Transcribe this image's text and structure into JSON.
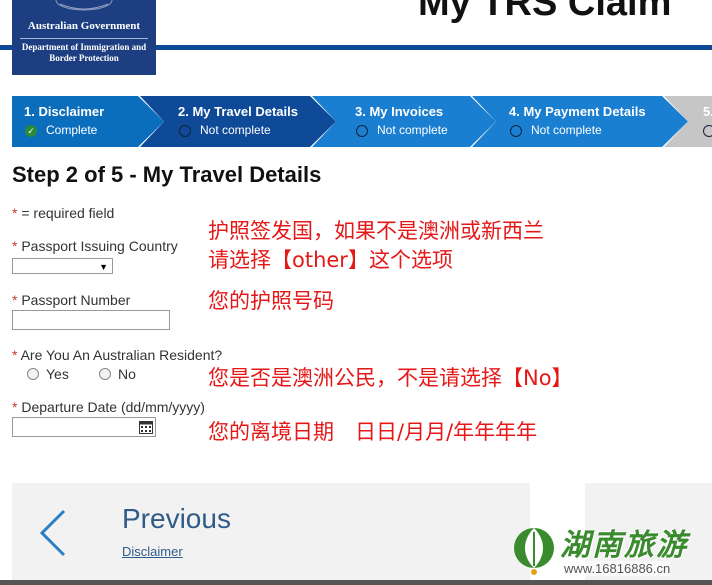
{
  "header": {
    "government": "Australian Government",
    "department": "Department of Immigration and Border Protection",
    "title": "My TRS Claim"
  },
  "steps": [
    {
      "label": "1. Disclaimer",
      "status": "Complete"
    },
    {
      "label": "2. My Travel Details",
      "status": "Not complete"
    },
    {
      "label": "3. My Invoices",
      "status": "Not complete"
    },
    {
      "label": "4. My Payment Details",
      "status": "Not complete"
    },
    {
      "label": "5.",
      "status": ""
    }
  ],
  "form": {
    "heading": "Step 2 of 5 - My Travel Details",
    "required_asterisk": "*",
    "required_note": "= required field",
    "passport_country_label": "Passport Issuing Country",
    "passport_country_value": "",
    "passport_number_label": "Passport Number",
    "passport_number_value": "",
    "resident_label": "Are You An Australian Resident?",
    "resident_yes": "Yes",
    "resident_no": "No",
    "departure_label": "Departure Date (dd/mm/yyyy)",
    "departure_value": ""
  },
  "annotations": {
    "country_line1": "护照签发国，如果不是澳洲或新西兰",
    "country_line2": "请选择【other】这个选项",
    "passport": "您的护照号码",
    "resident": "您是否是澳洲公民，不是请选择【No】",
    "departure": "您的离境日期　日日/月月/年年年年"
  },
  "nav": {
    "previous_label": "Previous",
    "previous_sub": "Disclaimer"
  },
  "watermark": {
    "title": "湖南旅游",
    "url": "www.16816886.cn"
  },
  "colors": {
    "step_done": "#0a6ebd",
    "step_active": "#0e4a97",
    "step_pending": "#1a7fd0",
    "step_disabled": "#c6c6c6",
    "annotation": "#e51717",
    "link": "#2f5b87"
  }
}
